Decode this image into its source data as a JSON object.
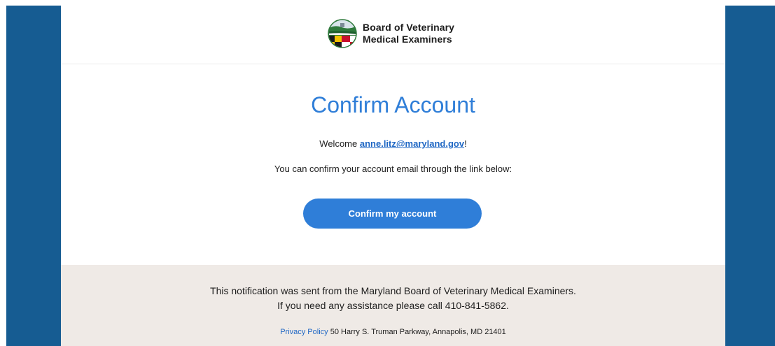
{
  "colors": {
    "side_band": "#165c92",
    "accent": "#2f7ed8",
    "link": "#1f67c4",
    "footer_bg": "#efeae6"
  },
  "header": {
    "logo_icon": "maryland-seal-icon",
    "org_line1": "Board of Veterinary",
    "org_line2": "Medical Examiners"
  },
  "main": {
    "title": "Confirm Account",
    "welcome_prefix": "Welcome ",
    "welcome_email": "anne.litz@maryland.gov",
    "welcome_suffix": "!",
    "instructions": "You can confirm your account email through the link below:",
    "confirm_button": "Confirm my account"
  },
  "footer": {
    "line1": "This notification was sent from the Maryland Board of Veterinary Medical Examiners.",
    "line2": "If you need any assistance please call 410-841-5862.",
    "privacy_link": "Privacy Policy",
    "address": " 50 Harry S. Truman Parkway, Annapolis, MD 21401"
  }
}
